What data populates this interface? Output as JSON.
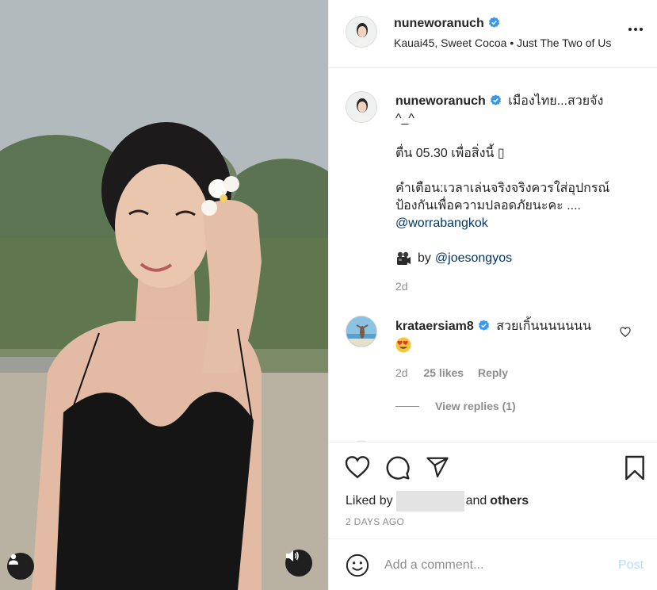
{
  "post": {
    "username": "nuneworanuch",
    "music": "Kauai45, Sweet Cocoa • Just The Two of Us"
  },
  "caption": {
    "username": "nuneworanuch",
    "line1": "เมืองไทย...สวยจัง",
    "line1b": "^_^",
    "line2": "ตื่น 05.30 เพื่อสิ่งนี้ ▯",
    "line3": "คำเตือน:เวลาเล่นจริงจริงควรใส่อุปกรณ์ป้องกันเพื่อความปลอดภัยนะคะ ....",
    "mention1": "@worrabangkok",
    "credit_icon": "movie-camera-emoji",
    "credit_by": "by",
    "mention2": "@joesongyos",
    "time": "2d"
  },
  "comment": {
    "username": "krataersiam8",
    "text": "สวยเกิ้นนนนนนน",
    "emoji": "heart-eyes-emoji",
    "time": "2d",
    "likes": "25 likes",
    "reply": "Reply",
    "view_replies": "View replies (1)"
  },
  "likes": {
    "prefix": "Liked by",
    "and": "and",
    "others": "others"
  },
  "date": "2 DAYS AGO",
  "add_comment": {
    "placeholder": "Add a comment...",
    "post": "Post"
  },
  "colors": {
    "verified": "#3897f0",
    "link": "#00376b",
    "muted": "#8e8e8e",
    "post_disabled": "#b2dffc",
    "dress": "#151515"
  },
  "icons": [
    "verified-badge-icon",
    "more-icon",
    "heart-icon",
    "comment-icon",
    "share-icon",
    "bookmark-icon",
    "emoji-icon",
    "user-tag-icon",
    "speaker-icon"
  ]
}
